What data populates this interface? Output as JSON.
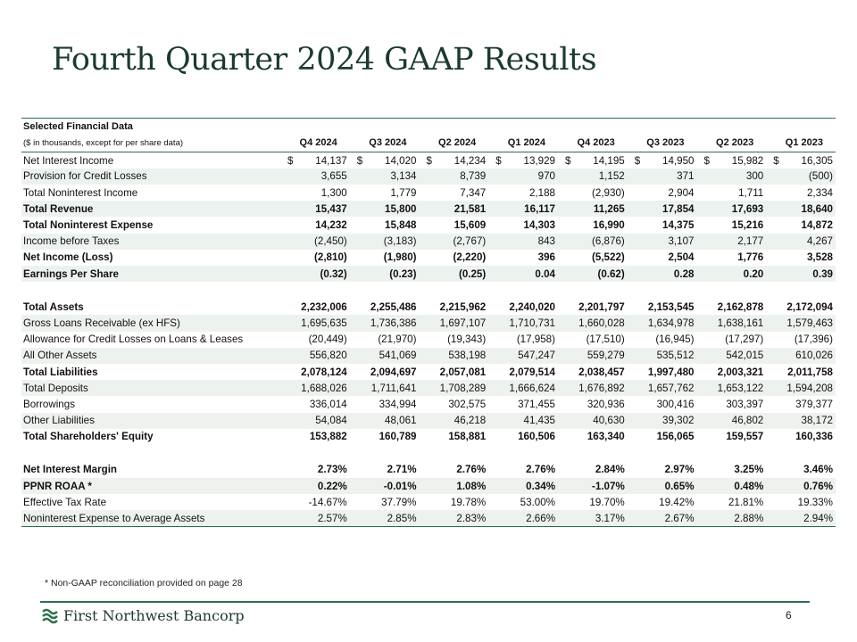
{
  "title": "Fourth Quarter 2024 GAAP Results",
  "table": {
    "section_title": "Selected Financial Data",
    "subtitle": "($ in thousands, except for per share data)",
    "columns": [
      "Q4 2024",
      "Q3 2024",
      "Q2 2024",
      "Q1 2024",
      "Q4 2023",
      "Q3 2023",
      "Q2 2023",
      "Q1 2023"
    ],
    "currency_symbol": "$",
    "rows": [
      {
        "label": "Net Interest Income",
        "values": [
          "14,137",
          "14,020",
          "14,234",
          "13,929",
          "14,195",
          "14,950",
          "15,982",
          "16,305"
        ]
      },
      {
        "label": "Provision for Credit Losses",
        "values": [
          "3,655",
          "3,134",
          "8,739",
          "970",
          "1,152",
          "371",
          "300",
          "(500)"
        ]
      },
      {
        "label": "Total Noninterest Income",
        "values": [
          "1,300",
          "1,779",
          "7,347",
          "2,188",
          "(2,930)",
          "2,904",
          "1,711",
          "2,334"
        ]
      },
      {
        "label": "Total Revenue",
        "values": [
          "15,437",
          "15,800",
          "21,581",
          "16,117",
          "11,265",
          "17,854",
          "17,693",
          "18,640"
        ]
      },
      {
        "label": "Total Noninterest Expense",
        "values": [
          "14,232",
          "15,848",
          "15,609",
          "14,303",
          "16,990",
          "14,375",
          "15,216",
          "14,872"
        ]
      },
      {
        "label": "Income before Taxes",
        "values": [
          "(2,450)",
          "(3,183)",
          "(2,767)",
          "843",
          "(6,876)",
          "3,107",
          "2,177",
          "4,267"
        ]
      },
      {
        "label": "Net Income (Loss)",
        "values": [
          "(2,810)",
          "(1,980)",
          "(2,220)",
          "396",
          "(5,522)",
          "2,504",
          "1,776",
          "3,528"
        ]
      },
      {
        "label": "Earnings Per Share",
        "values": [
          "(0.32)",
          "(0.23)",
          "(0.25)",
          "0.04",
          "(0.62)",
          "0.28",
          "0.20",
          "0.39"
        ]
      },
      {
        "label": "Total Assets",
        "values": [
          "2,232,006",
          "2,255,486",
          "2,215,962",
          "2,240,020",
          "2,201,797",
          "2,153,545",
          "2,162,878",
          "2,172,094"
        ]
      },
      {
        "label": "Gross Loans Receivable (ex HFS)",
        "values": [
          "1,695,635",
          "1,736,386",
          "1,697,107",
          "1,710,731",
          "1,660,028",
          "1,634,978",
          "1,638,161",
          "1,579,463"
        ]
      },
      {
        "label": "Allowance for Credit Losses on Loans & Leases",
        "values": [
          "(20,449)",
          "(21,970)",
          "(19,343)",
          "(17,958)",
          "(17,510)",
          "(16,945)",
          "(17,297)",
          "(17,396)"
        ]
      },
      {
        "label": "All Other Assets",
        "values": [
          "556,820",
          "541,069",
          "538,198",
          "547,247",
          "559,279",
          "535,512",
          "542,015",
          "610,026"
        ]
      },
      {
        "label": "Total Liabilities",
        "values": [
          "2,078,124",
          "2,094,697",
          "2,057,081",
          "2,079,514",
          "2,038,457",
          "1,997,480",
          "2,003,321",
          "2,011,758"
        ]
      },
      {
        "label": "Total Deposits",
        "values": [
          "1,688,026",
          "1,711,641",
          "1,708,289",
          "1,666,624",
          "1,676,892",
          "1,657,762",
          "1,653,122",
          "1,594,208"
        ]
      },
      {
        "label": "Borrowings",
        "values": [
          "336,014",
          "334,994",
          "302,575",
          "371,455",
          "320,936",
          "300,416",
          "303,397",
          "379,377"
        ]
      },
      {
        "label": "Other Liabilities",
        "values": [
          "54,084",
          "48,061",
          "46,218",
          "41,435",
          "40,630",
          "39,302",
          "46,802",
          "38,172"
        ]
      },
      {
        "label": "Total Shareholders' Equity",
        "values": [
          "153,882",
          "160,789",
          "158,881",
          "160,506",
          "163,340",
          "156,065",
          "159,557",
          "160,336"
        ]
      },
      {
        "label": "Net Interest Margin",
        "values": [
          "2.73%",
          "2.71%",
          "2.76%",
          "2.76%",
          "2.84%",
          "2.97%",
          "3.25%",
          "3.46%"
        ]
      },
      {
        "label": "PPNR ROAA *",
        "values": [
          "0.22%",
          "-0.01%",
          "1.08%",
          "0.34%",
          "-1.07%",
          "0.65%",
          "0.48%",
          "0.76%"
        ]
      },
      {
        "label": "Effective Tax Rate",
        "values": [
          "-14.67%",
          "37.79%",
          "19.78%",
          "53.00%",
          "19.70%",
          "19.42%",
          "21.81%",
          "19.33%"
        ]
      },
      {
        "label": "Noninterest Expense to Average Assets",
        "values": [
          "2.57%",
          "2.85%",
          "2.83%",
          "2.66%",
          "3.17%",
          "2.67%",
          "2.88%",
          "2.94%"
        ]
      }
    ]
  },
  "footnote": "* Non-GAAP reconciliation provided on page 28",
  "footer": {
    "logo_text": "First Northwest Bancorp",
    "logo_icon": "wave-logo-icon",
    "page_number": "6",
    "accent_color": "#2d6e4a"
  }
}
